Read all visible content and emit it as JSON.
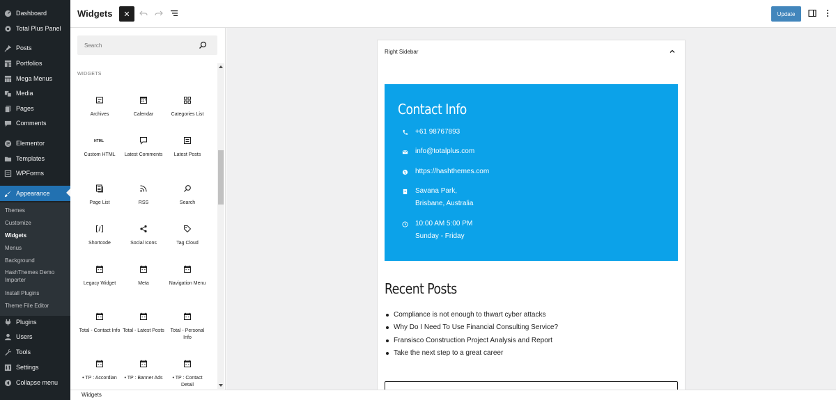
{
  "admin_menu": {
    "items": [
      {
        "label": "Dashboard",
        "icon": "dashboard-icon"
      },
      {
        "label": "Total Plus Panel",
        "icon": "gear-icon"
      },
      {
        "label": "Posts",
        "icon": "pin-icon"
      },
      {
        "label": "Portfolios",
        "icon": "grid-icon"
      },
      {
        "label": "Mega Menus",
        "icon": "columns-icon"
      },
      {
        "label": "Media",
        "icon": "media-icon"
      },
      {
        "label": "Pages",
        "icon": "pages-icon"
      },
      {
        "label": "Comments",
        "icon": "comment-icon"
      },
      {
        "label": "Elementor",
        "icon": "elementor-icon"
      },
      {
        "label": "Templates",
        "icon": "folder-icon"
      },
      {
        "label": "WPForms",
        "icon": "forms-icon"
      },
      {
        "label": "Appearance",
        "icon": "brush-icon"
      },
      {
        "label": "Plugins",
        "icon": "plugin-icon"
      },
      {
        "label": "Users",
        "icon": "user-icon"
      },
      {
        "label": "Tools",
        "icon": "wrench-icon"
      },
      {
        "label": "Settings",
        "icon": "settings-icon"
      },
      {
        "label": "Collapse menu",
        "icon": "collapse-icon"
      }
    ],
    "submenu": [
      {
        "label": "Themes"
      },
      {
        "label": "Customize"
      },
      {
        "label": "Widgets"
      },
      {
        "label": "Menus"
      },
      {
        "label": "Background"
      },
      {
        "label": "HashThemes Demo Importer"
      },
      {
        "label": "Install Plugins"
      },
      {
        "label": "Theme File Editor"
      }
    ],
    "active_color": "#2271b1"
  },
  "header": {
    "title": "Widgets",
    "close_symbol": "✕",
    "update_label": "Update"
  },
  "inserter": {
    "search_placeholder": "Search",
    "section_title": "WIDGETS",
    "blocks": [
      {
        "label": "Archives",
        "icon": "archive-icon"
      },
      {
        "label": "Calendar",
        "icon": "calendar-icon"
      },
      {
        "label": "Categories List",
        "icon": "categories-icon"
      },
      {
        "label": "Custom HTML",
        "icon": "html-icon"
      },
      {
        "label": "Latest Comments",
        "icon": "comment-icon"
      },
      {
        "label": "Latest Posts",
        "icon": "list-icon"
      },
      {
        "label": "Page List",
        "icon": "page-list-icon"
      },
      {
        "label": "RSS",
        "icon": "rss-icon"
      },
      {
        "label": "Search",
        "icon": "search-icon"
      },
      {
        "label": "Shortcode",
        "icon": "shortcode-icon"
      },
      {
        "label": "Social Icons",
        "icon": "share-icon"
      },
      {
        "label": "Tag Cloud",
        "icon": "tag-icon"
      },
      {
        "label": "Legacy Widget",
        "icon": "widget-icon"
      },
      {
        "label": "Meta",
        "icon": "widget-icon"
      },
      {
        "label": "Navigation Menu",
        "icon": "widget-icon"
      },
      {
        "label": "Total - Contact Info",
        "icon": "widget-icon"
      },
      {
        "label": "Total - Latest Posts",
        "icon": "widget-icon"
      },
      {
        "label": "Total - Personal Info",
        "icon": "widget-icon"
      },
      {
        "label": "• TP : Accordian",
        "icon": "widget-icon"
      },
      {
        "label": "• TP : Banner Ads",
        "icon": "widget-icon"
      },
      {
        "label": "• TP : Contact Detail",
        "icon": "widget-icon"
      }
    ]
  },
  "canvas": {
    "area_title": "Right Sidebar",
    "contact": {
      "title": "Contact Info",
      "bg_color": "#0ca2e9",
      "phone": "+61 98767893",
      "email": "info@totalplus.com",
      "website": "https://hashthemes.com",
      "address_line1": "Savana Park,",
      "address_line2": "Brisbane, Australia",
      "hours_line1": "10:00 AM 5:00 PM",
      "hours_line2": "Sunday - Friday"
    },
    "recent": {
      "title": "Recent Posts",
      "posts": [
        "Compliance is not enough to thwart cyber attacks",
        "Why Do I Need To Use Financial Consulting Service?",
        "Fransisco Construction Project Analysis and Report",
        "Take the next step to a great career"
      ]
    }
  },
  "footer": {
    "breadcrumb": "Widgets"
  }
}
